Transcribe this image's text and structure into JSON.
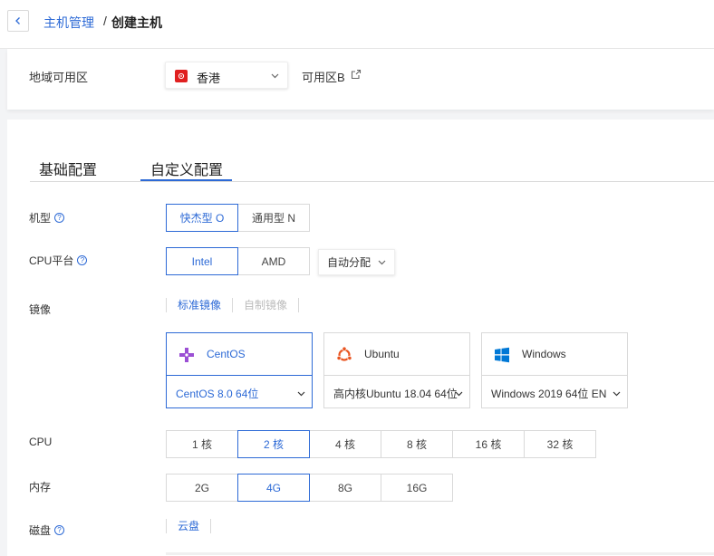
{
  "header": {
    "breadcrumb_link": "主机管理",
    "separator": "/",
    "current": "创建主机"
  },
  "region": {
    "label": "地域可用区",
    "selected": "香港",
    "zone": "可用区B"
  },
  "tabs": [
    {
      "label": "基础配置",
      "active": false
    },
    {
      "label": "自定义配置",
      "active": true
    }
  ],
  "machine_type": {
    "label": "机型",
    "options": [
      "快杰型 O",
      "通用型 N"
    ],
    "selected": "快杰型 O"
  },
  "cpu_platform": {
    "label": "CPU平台",
    "options": [
      "Intel",
      "AMD"
    ],
    "selected": "Intel",
    "auto_label": "自动分配"
  },
  "image": {
    "label": "镜像",
    "tabs": [
      "标准镜像",
      "自制镜像"
    ],
    "active_tab": "标准镜像",
    "os_cards": [
      {
        "name": "CentOS",
        "version": "CentOS 8.0 64位",
        "selected": true,
        "icon": "centos-icon"
      },
      {
        "name": "Ubuntu",
        "version": "高内核Ubuntu 18.04 64位",
        "selected": false,
        "icon": "ubuntu-icon"
      },
      {
        "name": "Windows",
        "version": "Windows 2019 64位 EN",
        "selected": false,
        "icon": "windows-icon"
      }
    ]
  },
  "cpu": {
    "label": "CPU",
    "options": [
      "1 核",
      "2 核",
      "4 核",
      "8 核",
      "16 核",
      "32 核"
    ],
    "selected": "2 核"
  },
  "memory": {
    "label": "内存",
    "options": [
      "2G",
      "4G",
      "8G",
      "16G"
    ],
    "selected": "4G"
  },
  "disk": {
    "label": "磁盘",
    "tabs": [
      "云盘"
    ]
  },
  "colors": {
    "accent": "#2d6ad6",
    "border": "#d9d9d9",
    "flag_red": "#e02020",
    "centos_purple": "#9b4fd4",
    "ubuntu_orange": "#e95420",
    "windows_blue": "#0078d6"
  }
}
